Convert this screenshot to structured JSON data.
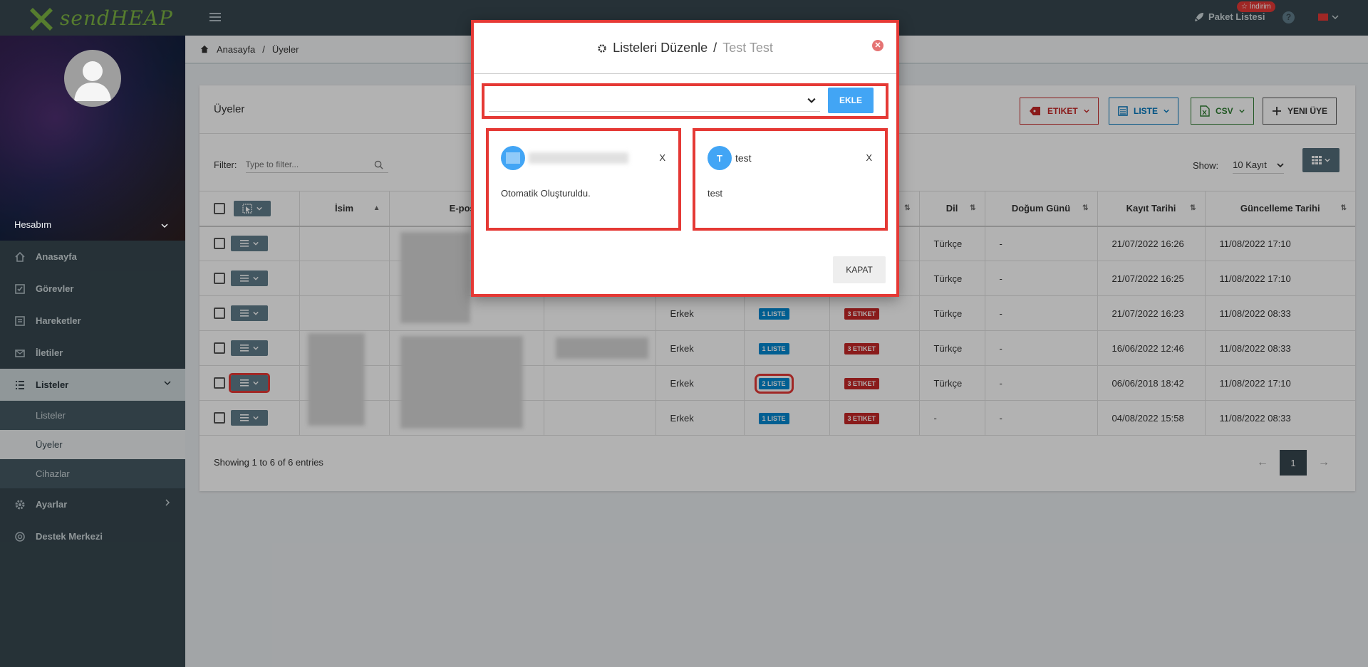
{
  "topbar": {
    "logo_text": "sendHEAP",
    "paket_label": "Paket Listesi",
    "indirim_label": "☆ İndirim",
    "help_label": "?"
  },
  "sidebar": {
    "account_label": "Hesabım",
    "items": [
      {
        "label": "Anasayfa",
        "icon": "home-icon"
      },
      {
        "label": "Görevler",
        "icon": "check-square-icon"
      },
      {
        "label": "Hareketler",
        "icon": "list-alt-icon"
      },
      {
        "label": "İletiler",
        "icon": "envelope-icon"
      },
      {
        "label": "Listeler",
        "icon": "list-icon"
      }
    ],
    "sub_items": [
      "Listeler",
      "Üyeler",
      "Cihazlar"
    ],
    "bottom_items": [
      {
        "label": "Ayarlar",
        "icon": "gear-icon"
      },
      {
        "label": "Destek Merkezi",
        "icon": "lifebuoy-icon"
      }
    ]
  },
  "breadcrumb": {
    "home": "Anasayfa",
    "sep": "/",
    "current": "Üyeler"
  },
  "card": {
    "title": "Üyeler",
    "buttons": {
      "etiket": "ETIKET",
      "liste": "LISTE",
      "csv": "CSV",
      "yeni": "YENI ÜYE"
    },
    "filter_label": "Filter:",
    "filter_placeholder": "Type to filter...",
    "show_label": "Show:",
    "show_value": "10 Kayıt",
    "columns": [
      "İsim",
      "E-posta",
      "",
      "",
      "",
      "",
      "Dil",
      "Doğum Günü",
      "Kayıt Tarihi",
      "Güncelleme Tarihi"
    ],
    "rows": [
      {
        "gender": "",
        "liste": "",
        "etiket": "",
        "dil": "Türkçe",
        "dogum": "-",
        "kayit": "21/07/2022 16:26",
        "guncelleme": "11/08/2022 17:10"
      },
      {
        "gender": "",
        "liste": "",
        "etiket": "",
        "dil": "Türkçe",
        "dogum": "-",
        "kayit": "21/07/2022 16:25",
        "guncelleme": "11/08/2022 17:10"
      },
      {
        "gender": "Erkek",
        "liste": "1 LISTE",
        "etiket": "3 ETIKET",
        "dil": "Türkçe",
        "dogum": "-",
        "kayit": "21/07/2022 16:23",
        "guncelleme": "11/08/2022 08:33"
      },
      {
        "gender": "Erkek",
        "liste": "1 LISTE",
        "etiket": "3 ETIKET",
        "dil": "Türkçe",
        "dogum": "-",
        "kayit": "16/06/2022 12:46",
        "guncelleme": "11/08/2022 08:33"
      },
      {
        "gender": "Erkek",
        "liste": "2 LISTE",
        "etiket": "3 ETIKET",
        "dil": "Türkçe",
        "dogum": "-",
        "kayit": "06/06/2018 18:42",
        "guncelleme": "11/08/2022 17:10"
      },
      {
        "gender": "Erkek",
        "liste": "1 LISTE",
        "etiket": "3 ETIKET",
        "dil": "-",
        "dogum": "-",
        "kayit": "04/08/2022 15:58",
        "guncelleme": "11/08/2022 08:33"
      }
    ],
    "footer": "Showing 1 to 6 of 6 entries",
    "page": "1",
    "prev": "←",
    "next": "→"
  },
  "modal": {
    "title": "Listeleri Düzenle",
    "sep": "/",
    "subtitle": "Test Test",
    "close_label": "✕",
    "ekle": "EKLE",
    "lists": [
      {
        "avatar": "",
        "name": "",
        "remove": "X",
        "desc": "Otomatik Oluşturuldu."
      },
      {
        "avatar": "T",
        "name": "test",
        "remove": "X",
        "desc": "test"
      }
    ],
    "kapat": "KAPAT"
  },
  "colors": {
    "accent_blue": "#42a5f5",
    "danger_red": "#e53935",
    "sidebar": "#37474f"
  }
}
